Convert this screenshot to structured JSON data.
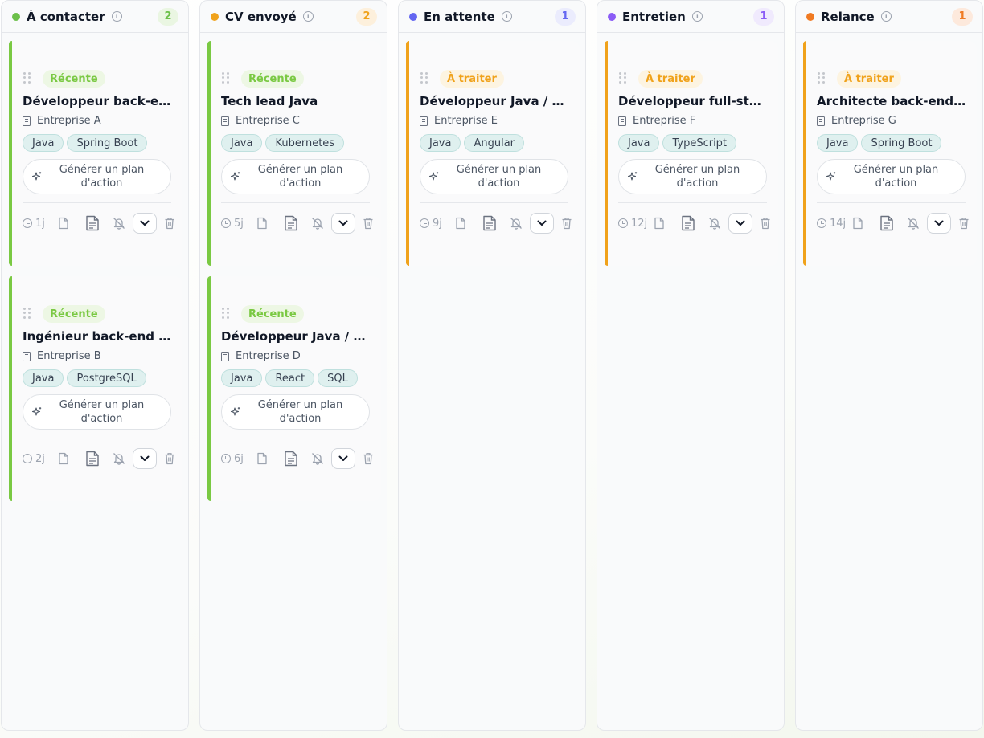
{
  "columns": [
    {
      "title": "À contacter",
      "count": "2",
      "dot_color": "#6cc04a",
      "count_bg": "#eaf6e2",
      "count_color": "#6cc04a",
      "cards": [
        {
          "badge": "Récente",
          "badge_kind": "green",
          "title": "Développeur back-end Java",
          "company": "Entreprise A",
          "tags": [
            "Java",
            "Spring Boot"
          ],
          "plan_label": "Générer un plan d'action",
          "age": "1j"
        },
        {
          "badge": "Récente",
          "badge_kind": "green",
          "title": "Ingénieur back-end Java",
          "company": "Entreprise B",
          "tags": [
            "Java",
            "PostgreSQL"
          ],
          "plan_label": "Générer un plan d'action",
          "age": "2j"
        }
      ]
    },
    {
      "title": "CV envoyé",
      "count": "2",
      "dot_color": "#f0a21b",
      "count_bg": "#fdf0dc",
      "count_color": "#f0a21b",
      "cards": [
        {
          "badge": "Récente",
          "badge_kind": "green",
          "title": "Tech lead Java",
          "company": "Entreprise C",
          "tags": [
            "Java",
            "Kubernetes"
          ],
          "plan_label": "Générer un plan d'action",
          "age": "5j"
        },
        {
          "badge": "Récente",
          "badge_kind": "green",
          "title": "Développeur Java / React",
          "company": "Entreprise D",
          "tags": [
            "Java",
            "React",
            "SQL"
          ],
          "plan_label": "Générer un plan d'action",
          "age": "6j"
        }
      ]
    },
    {
      "title": "En attente",
      "count": "1",
      "dot_color": "#6366f1",
      "count_bg": "#ebecfd",
      "count_color": "#6366f1",
      "cards": [
        {
          "badge": "À traiter",
          "badge_kind": "orange",
          "title": "Développeur Java / Angular",
          "company": "Entreprise E",
          "tags": [
            "Java",
            "Angular"
          ],
          "plan_label": "Générer un plan d'action",
          "age": "9j"
        }
      ]
    },
    {
      "title": "Entretien",
      "count": "1",
      "dot_color": "#8b5cf6",
      "count_bg": "#f0eafd",
      "count_color": "#8b5cf6",
      "cards": [
        {
          "badge": "À traiter",
          "badge_kind": "orange",
          "title": "Développeur full-stack",
          "company": "Entreprise F",
          "tags": [
            "Java",
            "TypeScript"
          ],
          "plan_label": "Générer un plan d'action",
          "age": "12j"
        }
      ]
    },
    {
      "title": "Relance",
      "count": "1",
      "dot_color": "#f07a22",
      "count_bg": "#fde9dc",
      "count_color": "#f07a22",
      "cards": [
        {
          "badge": "À traiter",
          "badge_kind": "orange",
          "title": "Architecte back-end Java",
          "company": "Entreprise G",
          "tags": [
            "Java",
            "Spring Boot"
          ],
          "plan_label": "Générer un plan d'action",
          "age": "14j"
        }
      ]
    }
  ],
  "icons": {
    "info": "info-icon",
    "drag": "drag-handle-icon",
    "company": "building-icon",
    "plan": "sparkle-icon",
    "age": "clock-icon",
    "file": "file-icon",
    "doc": "document-icon",
    "notify": "bell-off-icon",
    "select": "chevron-down-icon",
    "delete": "trash-icon"
  }
}
